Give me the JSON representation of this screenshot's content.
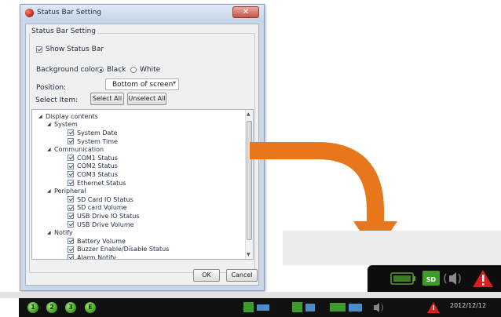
{
  "dialog": {
    "title": "Status Bar Setting",
    "group_title": "Status Bar Setting",
    "show_status_bar": {
      "label": "Show Status Bar",
      "checked": true
    },
    "background_color": {
      "label": "Background color:",
      "options": [
        "Black",
        "White"
      ],
      "selected": "Black"
    },
    "position": {
      "label": "Position:",
      "value": "Bottom of screen"
    },
    "select_item": {
      "label": "Select Item:",
      "select_all": "Select All",
      "unselect_all": "Unselect All"
    },
    "tree": [
      {
        "level": 0,
        "label": "Display contents",
        "type": "group"
      },
      {
        "level": 1,
        "label": "System",
        "type": "group"
      },
      {
        "level": 2,
        "label": "System Date",
        "checked": true
      },
      {
        "level": 2,
        "label": "System Time",
        "checked": true
      },
      {
        "level": 1,
        "label": "Communication",
        "type": "group"
      },
      {
        "level": 2,
        "label": "COM1 Status",
        "checked": true
      },
      {
        "level": 2,
        "label": "COM2 Status",
        "checked": true
      },
      {
        "level": 2,
        "label": "COM3 Status",
        "checked": true
      },
      {
        "level": 2,
        "label": "Ethernet Status",
        "checked": true
      },
      {
        "level": 1,
        "label": "Peripheral",
        "type": "group"
      },
      {
        "level": 2,
        "label": "SD Card IO Status",
        "checked": true
      },
      {
        "level": 2,
        "label": "SD card Volume",
        "checked": true
      },
      {
        "level": 2,
        "label": "USB Drive IO Status",
        "checked": true
      },
      {
        "level": 2,
        "label": "USB Drive Volume",
        "checked": true
      },
      {
        "level": 1,
        "label": "Notify",
        "type": "group"
      },
      {
        "level": 2,
        "label": "Battery Volume",
        "checked": true
      },
      {
        "level": 2,
        "label": "Buzzer Enable/Disable Status",
        "checked": true
      },
      {
        "level": 2,
        "label": "Alarm Notify",
        "checked": true
      }
    ],
    "ok_label": "OK",
    "cancel_label": "Cancel",
    "close_symbol": "✕"
  },
  "status_bar": {
    "com_labels": [
      "1",
      "2",
      "3",
      "E"
    ],
    "sd_label": "SD",
    "date": "2012/12/12",
    "accent_green": "#3d9b1f",
    "alarm_red": "#d81e1e",
    "arrow_orange": "#e8761a"
  }
}
